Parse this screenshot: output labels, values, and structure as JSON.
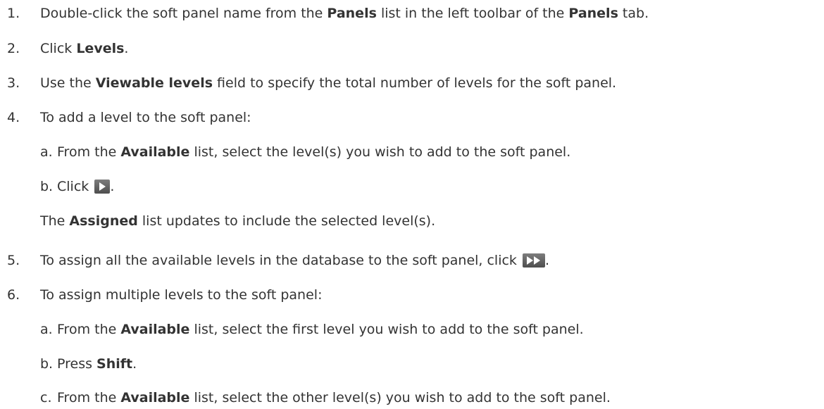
{
  "steps": [
    {
      "num": "1.",
      "parts": [
        "Double-click the soft panel name from the ",
        "Panels",
        " list in the left toolbar of the ",
        "Panels",
        " tab."
      ]
    },
    {
      "num": "2.",
      "parts": [
        "Click ",
        "Levels",
        "."
      ]
    },
    {
      "num": "3.",
      "parts": [
        "Use the ",
        "Viewable levels",
        " field to specify the total number of levels for the soft panel."
      ]
    },
    {
      "num": "4.",
      "text": "To add a level to the soft panel:",
      "substeps": [
        {
          "num": "a.",
          "parts": [
            "From the ",
            "Available",
            " list, select the level(s) you wish to add to the soft panel."
          ]
        },
        {
          "num": "b.",
          "parts": [
            "Click ",
            "."
          ]
        }
      ],
      "note_parts": [
        "The ",
        "Assigned",
        " list updates to include the selected level(s)."
      ]
    },
    {
      "num": "5.",
      "parts": [
        "To assign all the available levels in the database to the soft panel, click ",
        "."
      ]
    },
    {
      "num": "6.",
      "text": "To assign multiple levels to the soft panel:",
      "substeps": [
        {
          "num": "a.",
          "parts": [
            "From the ",
            "Available",
            " list, select the first level you wish to add to the soft panel."
          ]
        },
        {
          "num": "b.",
          "parts": [
            "Press ",
            "Shift",
            "."
          ]
        },
        {
          "num": "c.",
          "parts": [
            "From the ",
            "Available",
            " list, select the other level(s) you wish to add to the soft panel."
          ]
        }
      ]
    }
  ],
  "icons": {
    "add_selected": "play-arrow-icon",
    "add_all": "double-arrow-icon",
    "icon_color": "#5a5a5a"
  }
}
